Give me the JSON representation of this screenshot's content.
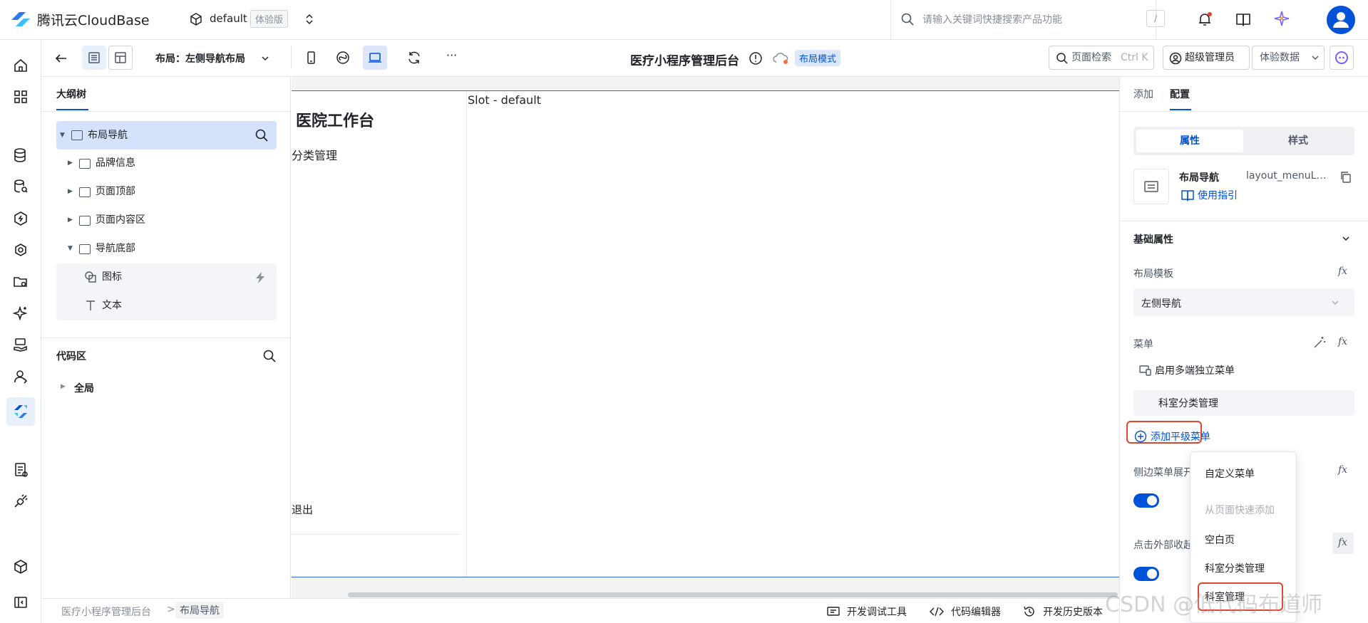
{
  "header": {
    "product_name": "腾讯云CloudBase",
    "env_name": "default",
    "env_badge": "体验版",
    "search_placeholder": "请输入关键词快捷搜索产品功能",
    "search_shortcut": "/"
  },
  "toolbar": {
    "layout_label": "布局：左侧导航布局",
    "app_title": "医疗小程序管理后台",
    "mode_badge": "布局模式",
    "page_search_label": "页面检索",
    "page_search_shortcut": "Ctrl K",
    "admin_label": "超级管理员",
    "data_label": "体验数据",
    "more_label": "···"
  },
  "outline": {
    "tab_label": "大纲树",
    "root": "布局导航",
    "children": [
      "品牌信息",
      "页面顶部",
      "页面内容区",
      "导航底部"
    ],
    "grandchildren": [
      "图标",
      "文本"
    ],
    "code_title": "代码区",
    "global_label": "全局"
  },
  "canvas": {
    "hospital_title": "医院工作台",
    "nav_item": "分类管理",
    "slot_label": "Slot - default",
    "logout_label": "退出"
  },
  "config": {
    "tab_add": "添加",
    "tab_config": "配置",
    "seg_attr": "属性",
    "seg_style": "样式",
    "component_name": "布局导航",
    "component_id": "layout_menuLayout1",
    "usage_guide": "使用指引",
    "basic_title": "基础属性",
    "layout_template_label": "布局模板",
    "layout_template_value": "左侧导航",
    "menu_label": "菜单",
    "multi_menu_label": "启用多端独立菜单",
    "menu_item": "科室分类管理",
    "add_menu_label": "添加平级菜单",
    "side_menu_label": "侧边菜单展开",
    "outside_click_label": "点击外部收起",
    "fx_label": "fx"
  },
  "dropdown": {
    "items": [
      "自定义菜单",
      "从页面快速添加",
      "空白页",
      "科室分类管理",
      "科室管理"
    ]
  },
  "statusbar": {
    "crumb_app": "医疗小程序管理后台",
    "crumb_sep": ">",
    "crumb_page": "布局导航",
    "debug_tools": "开发调试工具",
    "code_editor": "代码编辑器",
    "history": "开发历史版本"
  },
  "watermark": "CSDN @低代码布道师",
  "colors": {
    "brand_blue": "#0052d9",
    "highlight_red": "#e0462e",
    "selection_bg": "#d5e2fb"
  }
}
